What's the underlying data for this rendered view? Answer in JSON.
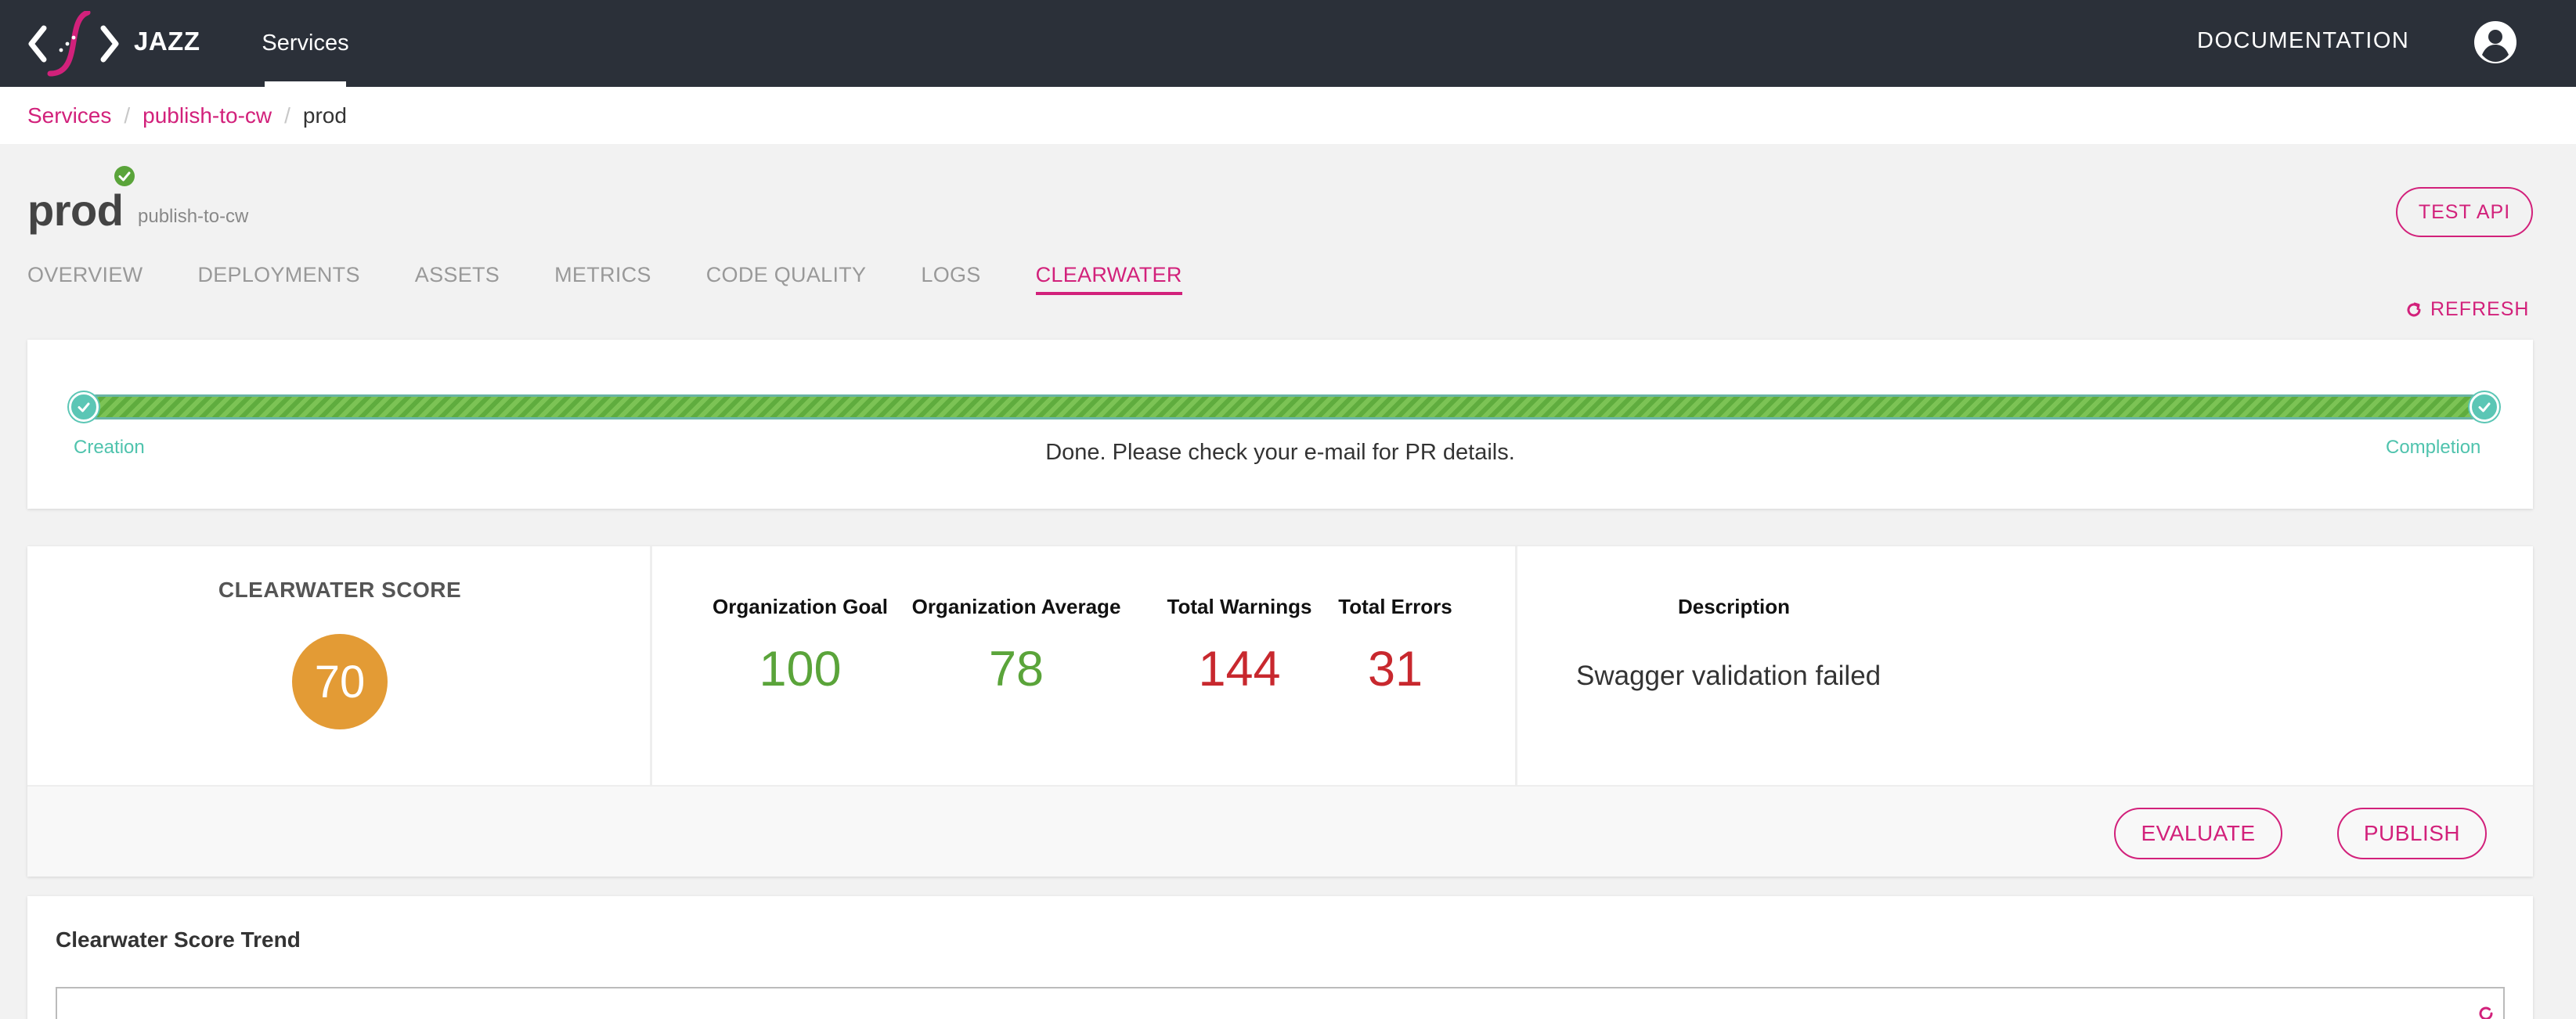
{
  "app": {
    "brand": "JAZZ",
    "nav_services": "Services",
    "nav_documentation": "DOCUMENTATION"
  },
  "breadcrumb": {
    "items": [
      "Services",
      "publish-to-cw"
    ],
    "separator": "/",
    "current": "prod"
  },
  "page": {
    "title": "prod",
    "subtitle": "publish-to-cw",
    "test_api_label": "TEST API",
    "refresh_label": "REFRESH"
  },
  "tabs": [
    {
      "label": "OVERVIEW",
      "active": false
    },
    {
      "label": "DEPLOYMENTS",
      "active": false
    },
    {
      "label": "ASSETS",
      "active": false
    },
    {
      "label": "METRICS",
      "active": false
    },
    {
      "label": "CODE QUALITY",
      "active": false
    },
    {
      "label": "LOGS",
      "active": false
    },
    {
      "label": "CLEARWATER",
      "active": true
    }
  ],
  "progress": {
    "start_label": "Creation",
    "end_label": "Completion",
    "message": "Done. Please check your e-mail for PR details.",
    "percent": 100
  },
  "score": {
    "title": "CLEARWATER SCORE",
    "value": "70",
    "metrics": {
      "goal": {
        "label": "Organization Goal",
        "value": "100"
      },
      "average": {
        "label": "Organization Average",
        "value": "78"
      },
      "warnings": {
        "label": "Total Warnings",
        "value": "144"
      },
      "errors": {
        "label": "Total Errors",
        "value": "31"
      }
    },
    "description_label": "Description",
    "description_text": "Swagger validation failed",
    "evaluate_label": "EVALUATE",
    "publish_label": "PUBLISH"
  },
  "trend": {
    "title": "Clearwater Score Trend"
  },
  "colors": {
    "header_bg": "#2b3039",
    "accent": "#d2217b",
    "success": "#5aa43a",
    "error": "#c8282e",
    "score_badge": "#e39b35",
    "progress_node": "#5bc6b5"
  }
}
